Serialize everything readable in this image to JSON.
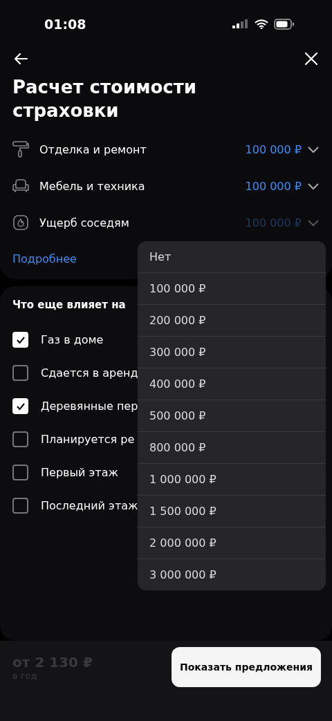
{
  "status_bar": {
    "time": "01:08"
  },
  "title": "Расчет стоимости страховки",
  "coverages": [
    {
      "label": "Отделка и ремонт",
      "value": "100 000 ₽",
      "expanded": false
    },
    {
      "label": "Мебель и техника",
      "value": "100 000 ₽",
      "expanded": false
    },
    {
      "label": "Ущерб соседям",
      "value": "100 000 ₽",
      "expanded": true
    }
  ],
  "more_link": "Подробнее",
  "factors": {
    "heading": "Что еще влияет на",
    "items": [
      {
        "label": "Газ в доме",
        "checked": true
      },
      {
        "label": "Сдается в аренд",
        "checked": false
      },
      {
        "label": "Деревянные пер",
        "checked": true
      },
      {
        "label": "Планируется ре",
        "checked": false
      },
      {
        "label": "Первый этаж",
        "checked": false
      },
      {
        "label": "Последний этаж",
        "checked": false
      }
    ]
  },
  "dropdown": [
    "Нет",
    "100 000 ₽",
    "200 000 ₽",
    "300 000 ₽",
    "400 000 ₽",
    "500 000 ₽",
    "800 000 ₽",
    "1 000 000 ₽",
    "1 500 000 ₽",
    "2 000 000 ₽",
    "3 000 000 ₽"
  ],
  "footer": {
    "price": "от 2 130 ₽",
    "period": "в год",
    "button": "Показать предложения"
  }
}
